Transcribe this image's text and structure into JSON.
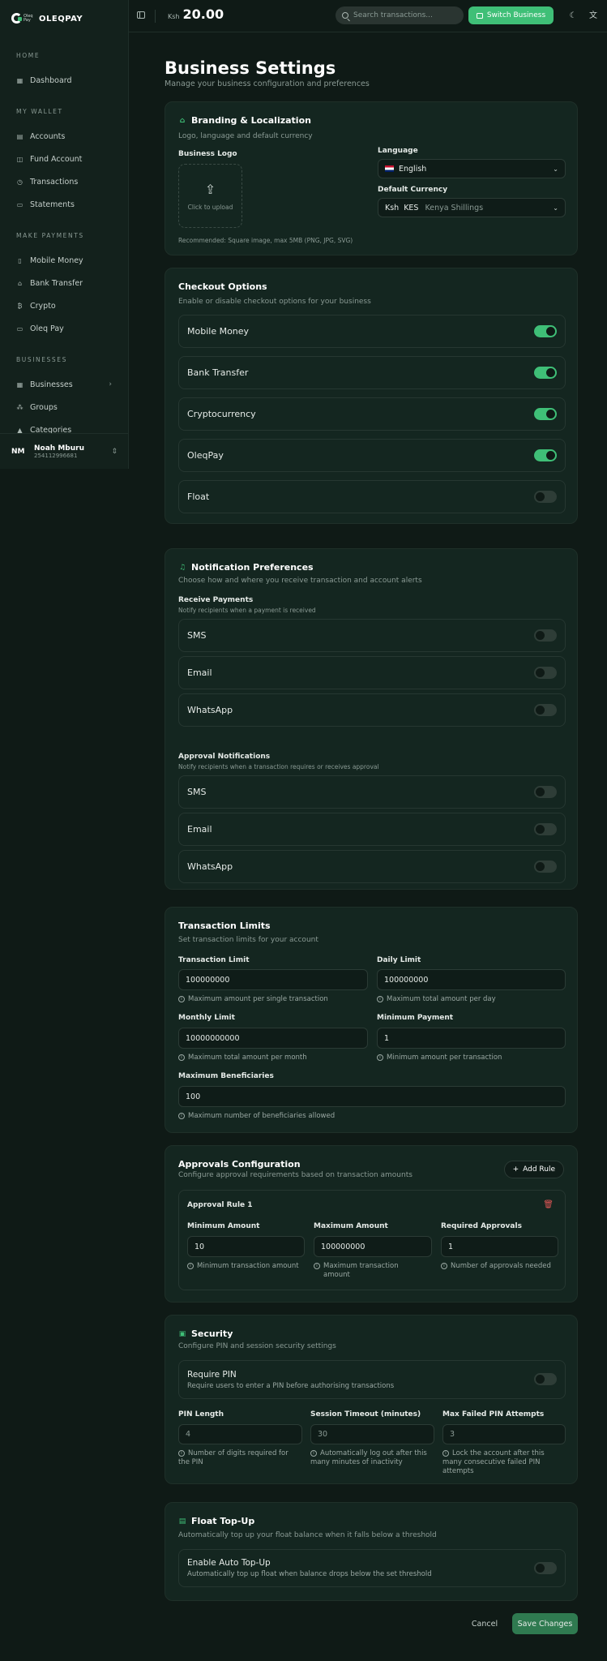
{
  "app": {
    "brand": "OLEQPAY",
    "brand_small": "Oleq Pay"
  },
  "sidebar": {
    "sections": [
      {
        "label": "HOME",
        "items": [
          {
            "label": "Dashboard",
            "icon": "dashboard-icon"
          }
        ]
      },
      {
        "label": "MY WALLET",
        "items": [
          {
            "label": "Accounts"
          },
          {
            "label": "Fund Account"
          },
          {
            "label": "Transactions"
          },
          {
            "label": "Statements"
          }
        ]
      },
      {
        "label": "MAKE PAYMENTS",
        "items": [
          {
            "label": "Mobile Money"
          },
          {
            "label": "Bank Transfer"
          },
          {
            "label": "Crypto"
          },
          {
            "label": "Oleq Pay"
          }
        ]
      },
      {
        "label": "BUSINESSES",
        "items": [
          {
            "label": "Businesses"
          },
          {
            "label": "Groups"
          },
          {
            "label": "Categories"
          }
        ]
      }
    ],
    "user": {
      "initials": "NM",
      "name": "Noah Mburu",
      "phone": "254112996681"
    }
  },
  "header": {
    "currency": "Ksh",
    "balance": "20.00",
    "search_placeholder": "Search transactions...",
    "switch_label": "Switch Business"
  },
  "page": {
    "title": "Business Settings",
    "subtitle": "Manage your business configuration and preferences"
  },
  "branding": {
    "title": "Branding & Localization",
    "subtitle": "Logo, language and default currency",
    "logo_label": "Business Logo",
    "upload_text": "Click to upload",
    "logo_hint": "Recommended: Square image, max 5MB (PNG, JPG, SVG)",
    "language_label": "Language",
    "language_value": "English",
    "currency_label": "Default Currency",
    "currency_symbol": "Ksh",
    "currency_code": "KES",
    "currency_name": "Kenya Shillings"
  },
  "checkout": {
    "title": "Checkout Options",
    "subtitle": "Enable or disable checkout options for your business",
    "options": [
      {
        "label": "Mobile Money",
        "on": true
      },
      {
        "label": "Bank Transfer",
        "on": true
      },
      {
        "label": "Cryptocurrency",
        "on": true
      },
      {
        "label": "OleqPay",
        "on": true
      },
      {
        "label": "Float",
        "on": false
      }
    ]
  },
  "notifications": {
    "title": "Notification Preferences",
    "subtitle": "Choose how and where you receive transaction and account alerts",
    "receive": {
      "title": "Receive Payments",
      "desc": "Notify recipients when a payment is received",
      "channels": [
        "SMS",
        "Email",
        "WhatsApp"
      ]
    },
    "approval": {
      "title": "Approval Notifications",
      "desc": "Notify recipients when a transaction requires or receives approval",
      "channels": [
        "SMS",
        "Email",
        "WhatsApp"
      ]
    }
  },
  "limits": {
    "title": "Transaction Limits",
    "subtitle": "Set transaction limits for your account",
    "transaction_limit": {
      "label": "Transaction Limit",
      "value": "100000000",
      "hint": "Maximum amount per single transaction"
    },
    "daily_limit": {
      "label": "Daily Limit",
      "value": "100000000",
      "hint": "Maximum total amount per day"
    },
    "monthly_limit": {
      "label": "Monthly Limit",
      "value": "10000000000",
      "hint": "Maximum total amount per month"
    },
    "minimum_payment": {
      "label": "Minimum Payment",
      "value": "1",
      "hint": "Minimum amount per transaction"
    },
    "max_beneficiaries": {
      "label": "Maximum Beneficiaries",
      "value": "100",
      "hint": "Maximum number of beneficiaries allowed"
    }
  },
  "approvals": {
    "title": "Approvals Configuration",
    "subtitle": "Configure approval requirements based on transaction amounts",
    "add_rule": "Add Rule",
    "rule": {
      "name": "Approval Rule 1",
      "min": {
        "label": "Minimum Amount",
        "value": "10",
        "hint": "Minimum transaction amount"
      },
      "max": {
        "label": "Maximum Amount",
        "value": "100000000",
        "hint_1": "Maximum transaction",
        "hint_2": "amount"
      },
      "req": {
        "label": "Required Approvals",
        "value": "1",
        "hint": "Number of approvals needed"
      }
    }
  },
  "security": {
    "title": "Security",
    "subtitle": "Configure PIN and session security settings",
    "require_pin": "Require PIN",
    "require_pin_desc": "Require users to enter a PIN before authorising transactions",
    "pin_length": {
      "label": "PIN Length",
      "value": "4",
      "hint_1": "Number of digits required for",
      "hint_2": "the PIN"
    },
    "session_timeout": {
      "label": "Session Timeout (minutes)",
      "value": "30",
      "hint_1": "Automatically log out after this",
      "hint_2": "many minutes of inactivity"
    },
    "max_failed": {
      "label": "Max Failed PIN Attempts",
      "value": "3",
      "hint_1": "Lock the account after this",
      "hint_2": "many consecutive failed PIN",
      "hint_3": "attempts"
    }
  },
  "float_topup": {
    "title": "Float Top-Up",
    "subtitle": "Automatically top up your float balance when it falls below a threshold",
    "enable_label": "Enable Auto Top-Up",
    "enable_desc": "Automatically top up float when balance drops below the set threshold"
  },
  "actions": {
    "cancel": "Cancel",
    "save": "Save Changes"
  },
  "colors": {
    "accent": "#3fbf77",
    "background": "#0f1a16",
    "card": "#142620",
    "danger": "#e05656"
  }
}
